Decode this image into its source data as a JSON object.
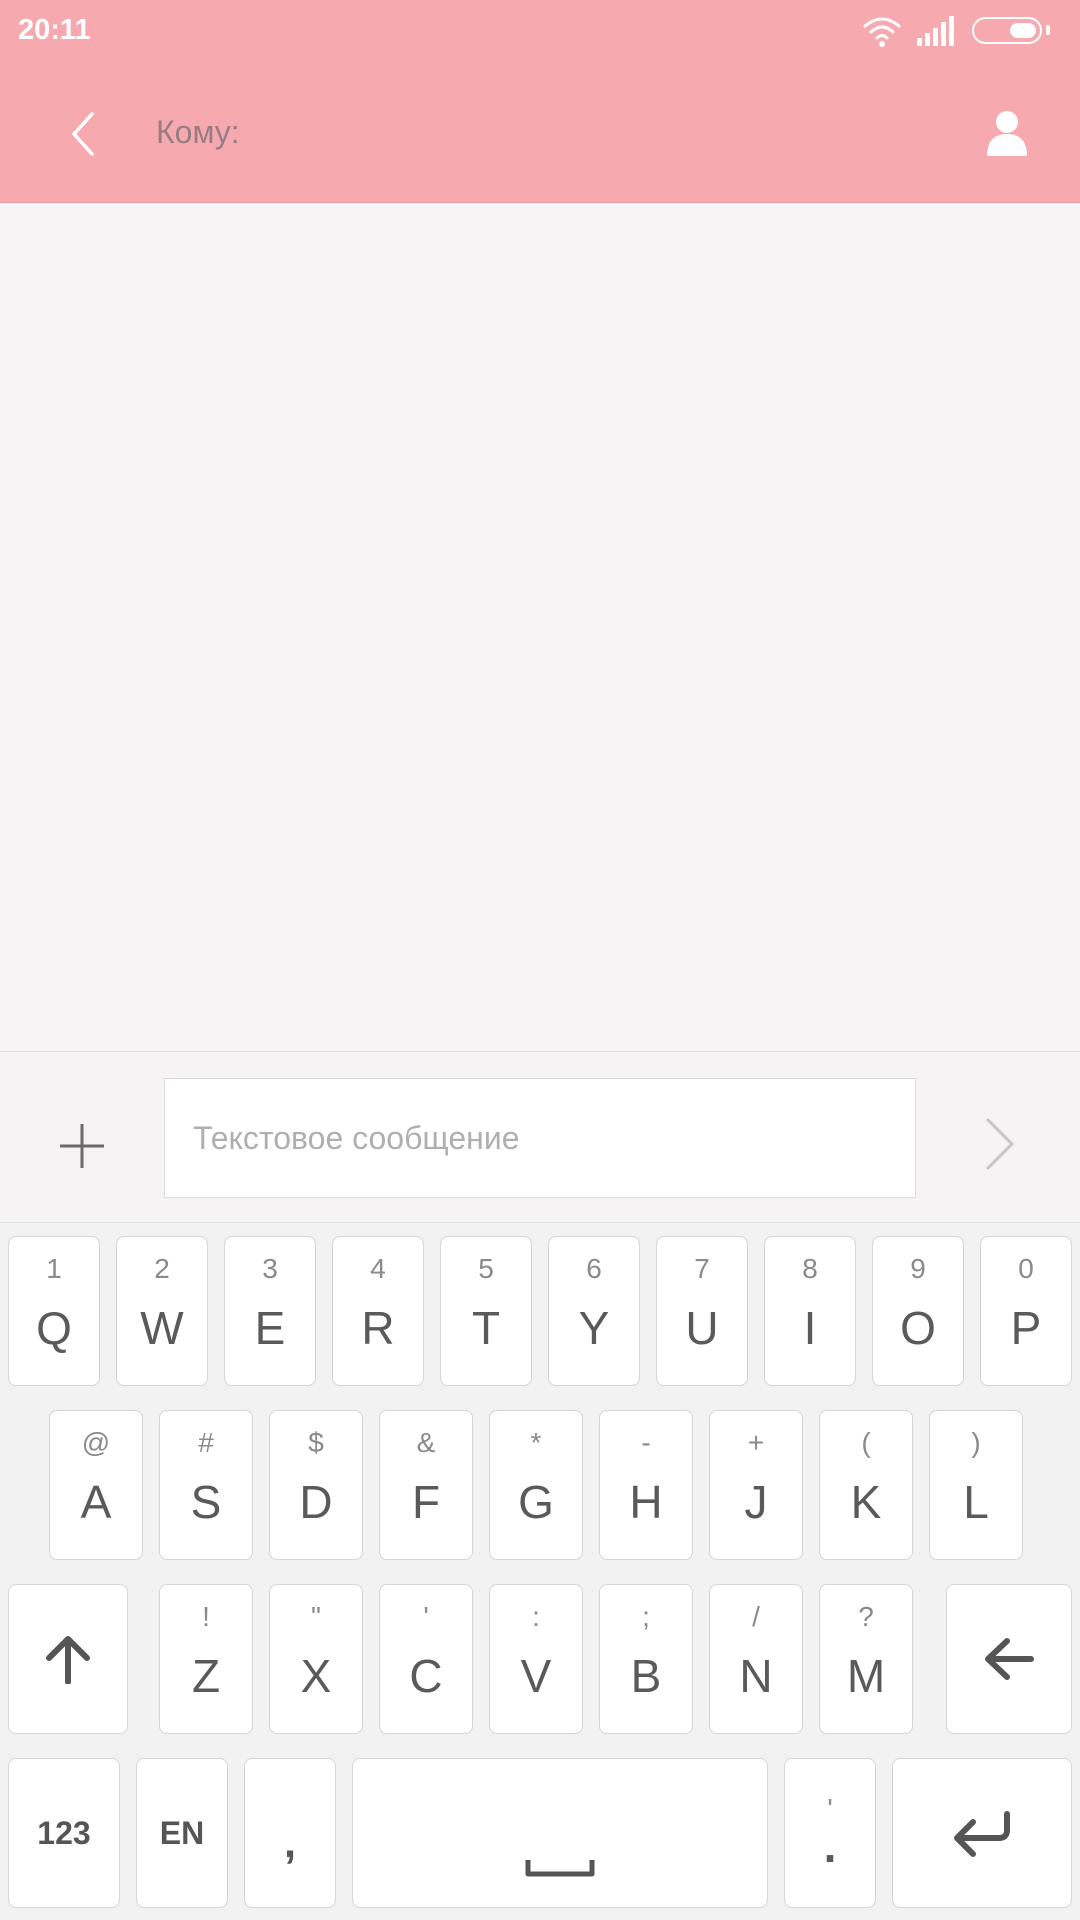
{
  "status_bar": {
    "time": "20:11",
    "icons": [
      "wifi-icon",
      "signal-icon",
      "battery-icon"
    ]
  },
  "header": {
    "back_icon": "chevron-left-icon",
    "to_label": "Кому:",
    "contact_icon": "person-icon"
  },
  "compose": {
    "attach_icon": "plus-icon",
    "placeholder": "Текстовое сообщение",
    "value": "",
    "send_icon": "chevron-right-icon"
  },
  "keyboard": {
    "row1": [
      {
        "hint": "1",
        "label": "Q"
      },
      {
        "hint": "2",
        "label": "W"
      },
      {
        "hint": "3",
        "label": "E"
      },
      {
        "hint": "4",
        "label": "R"
      },
      {
        "hint": "5",
        "label": "T"
      },
      {
        "hint": "6",
        "label": "Y"
      },
      {
        "hint": "7",
        "label": "U"
      },
      {
        "hint": "8",
        "label": "I"
      },
      {
        "hint": "9",
        "label": "O"
      },
      {
        "hint": "0",
        "label": "P"
      }
    ],
    "row2": [
      {
        "hint": "@",
        "label": "A"
      },
      {
        "hint": "#",
        "label": "S"
      },
      {
        "hint": "$",
        "label": "D"
      },
      {
        "hint": "&",
        "label": "F"
      },
      {
        "hint": "*",
        "label": "G"
      },
      {
        "hint": "-",
        "label": "H"
      },
      {
        "hint": "+",
        "label": "J"
      },
      {
        "hint": "(",
        "label": "K"
      },
      {
        "hint": ")",
        "label": "L"
      }
    ],
    "row3": [
      {
        "hint": "!",
        "label": "Z"
      },
      {
        "hint": "\"",
        "label": "X"
      },
      {
        "hint": "'",
        "label": "C"
      },
      {
        "hint": ":",
        "label": "V"
      },
      {
        "hint": ";",
        "label": "B"
      },
      {
        "hint": "/",
        "label": "N"
      },
      {
        "hint": "?",
        "label": "M"
      }
    ],
    "numbers_label": "123",
    "language_label": "EN",
    "comma_label": ",",
    "period_hint": "'",
    "period_label": ".",
    "shift_icon": "arrow-up-icon",
    "backspace_icon": "arrow-left-icon",
    "space_icon": "space-bar-icon",
    "enter_icon": "enter-icon"
  },
  "colors": {
    "header_bg": "#f7a9b0",
    "page_bg": "#f7f4f5",
    "keyboard_bg": "#f3f2f2"
  }
}
